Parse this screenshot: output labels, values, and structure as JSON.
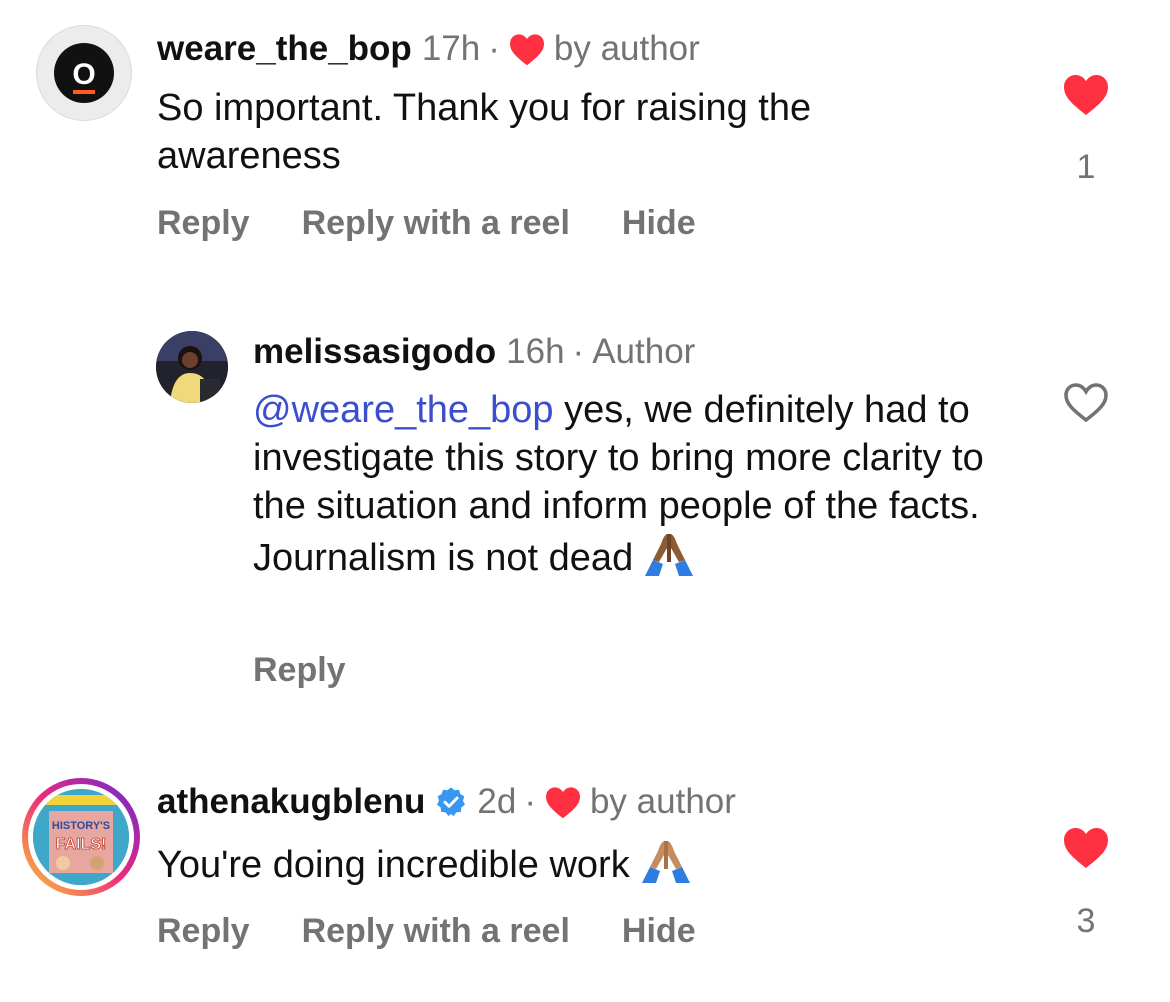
{
  "comments": [
    {
      "username": "weare_the_bop",
      "time": "17h",
      "separator": "·",
      "author_badge": "by author",
      "text": "So important. Thank you for raising the awareness",
      "actions": {
        "reply": "Reply",
        "reply_reel": "Reply with a reel",
        "hide": "Hide"
      },
      "likes": "1",
      "liked": true,
      "avatar_icon": "bop-logo-icon",
      "avatar_letter": "O"
    },
    {
      "username": "melissasigodo",
      "time": "16h",
      "separator": "·",
      "author_label": "Author",
      "mention": "@weare_the_bop",
      "text": " yes, we definitely had to investigate this story to bring more clarity to the situation and inform people of the facts. Journalism is not dead",
      "actions": {
        "reply": "Reply"
      },
      "liked": false,
      "emoji": "praying-hands"
    },
    {
      "username": "athenakugblenu",
      "verified": true,
      "time": "2d",
      "separator": "·",
      "author_badge": "by author",
      "text": "You're doing incredible work",
      "actions": {
        "reply": "Reply",
        "reply_reel": "Reply with a reel",
        "hide": "Hide"
      },
      "likes": "3",
      "liked": true,
      "emoji": "praying-hands",
      "has_story_ring": true,
      "avatar_text": "HISTORY'S FAILS!"
    }
  ],
  "colors": {
    "like_red": "#ff3040",
    "muted": "#737373",
    "mention_blue": "#3b4fce",
    "verified_blue": "#3897f0"
  }
}
